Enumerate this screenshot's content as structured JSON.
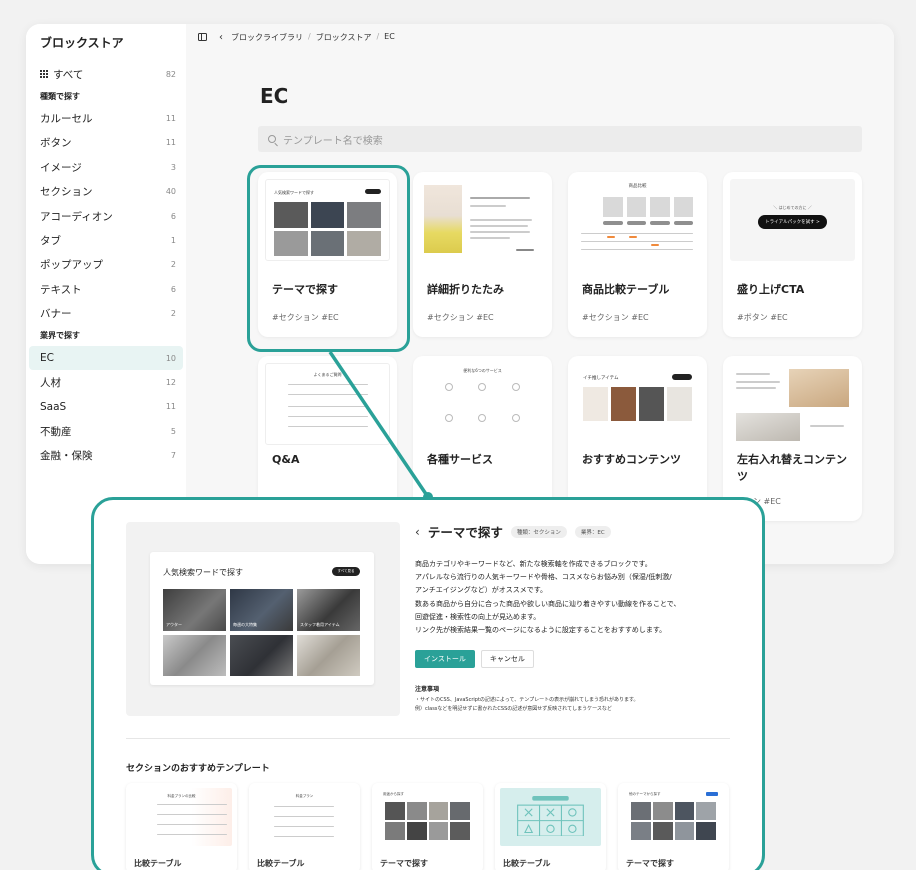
{
  "sidebar": {
    "title": "ブロックストア",
    "all": {
      "label": "すべて",
      "count": "82"
    },
    "type_heading": "種類で探す",
    "types": [
      {
        "label": "カルーセル",
        "count": "11"
      },
      {
        "label": "ボタン",
        "count": "11"
      },
      {
        "label": "イメージ",
        "count": "3"
      },
      {
        "label": "セクション",
        "count": "40"
      },
      {
        "label": "アコーディオン",
        "count": "6"
      },
      {
        "label": "タブ",
        "count": "1"
      },
      {
        "label": "ポップアップ",
        "count": "2"
      },
      {
        "label": "テキスト",
        "count": "6"
      },
      {
        "label": "バナー",
        "count": "2"
      }
    ],
    "industry_heading": "業界で探す",
    "industries": [
      {
        "label": "EC",
        "count": "10"
      },
      {
        "label": "人材",
        "count": "12"
      },
      {
        "label": "SaaS",
        "count": "11"
      },
      {
        "label": "不動産",
        "count": "5"
      },
      {
        "label": "金融・保険",
        "count": "7"
      }
    ]
  },
  "breadcrumb": {
    "items": [
      "ブロックライブラリ",
      "ブロックストア",
      "EC"
    ],
    "sep": "/"
  },
  "page": {
    "title": "EC"
  },
  "search": {
    "placeholder": "テンプレート名で検索"
  },
  "cards": [
    {
      "title": "テーマで探す",
      "tags": "#セクション  #EC",
      "thumb_title": "人気検索ワードで探す"
    },
    {
      "title": "詳細折りたたみ",
      "tags": "#セクション  #EC"
    },
    {
      "title": "商品比較テーブル",
      "tags": "#セクション  #EC",
      "thumb_title": "商品比較"
    },
    {
      "title": "盛り上げCTA",
      "tags": "#ボタン  #EC",
      "thumb_caption": "＼ はじめての方に ／",
      "thumb_button": "トライアルパックを試す  >"
    },
    {
      "title": "Q&A",
      "tags": "",
      "thumb_title": "よくあるご質問"
    },
    {
      "title": "各種サービス",
      "tags": "",
      "thumb_title": "便利な6つのサービス"
    },
    {
      "title": "おすすめコンテンツ",
      "tags": "",
      "thumb_title": "イチ推しアイテム"
    },
    {
      "title": "左右入れ替えコンテンツ",
      "tags": "ション  #EC"
    }
  ],
  "detail": {
    "title": "テーマで探す",
    "badges": [
      "種類：セクション",
      "業界：EC"
    ],
    "preview": {
      "title": "人気検索ワードで探す",
      "button": "すべて見る",
      "photos": [
        "アウター",
        "毎週の大特集",
        "スタッフ着用アイテム",
        "",
        "",
        ""
      ]
    },
    "description": [
      "商品カテゴリやキーワードなど、新たな検索軸を作成できるブロックです。",
      "アパレルなら流行りの人気キーワードや骨格、コスメならお悩み別（保湿/低刺激/",
      "アンチエイジングなど）がオススメです。",
      "数ある商品から自分に合った商品や欲しい商品に辿り着きやすい動線を作ることで、",
      "回遊促進・検索性の向上が見込めます。",
      "リンク先が検索結果一覧のページになるように設定することをおすすめします。"
    ],
    "install_label": "インストール",
    "cancel_label": "キャンセル",
    "notes_title": "注意事項",
    "notes": [
      "・サイトのCSS、JavaScriptの記述によって、テンプレートの表示が崩れてしまう恐れがあります。",
      "例）classなどを明記せずに書かれたCSSの記述が意図せず反映されてしまうケースなど"
    ]
  },
  "recommend": {
    "title": "セクションのおすすめテンプレート",
    "cards": [
      {
        "label": "比較テーブル",
        "thumb_title": "料金プランの比較"
      },
      {
        "label": "比較テーブル",
        "thumb_title": "料金プラン"
      },
      {
        "label": "テーマで探す",
        "thumb_title": "用途から探す"
      },
      {
        "label": "比較テーブル",
        "thumb_title": ""
      },
      {
        "label": "テーマで探す",
        "thumb_title": "他のテーマから探す"
      }
    ]
  },
  "colors": {
    "accent": "#2aa198",
    "active_bg": "#e8f4f3"
  }
}
